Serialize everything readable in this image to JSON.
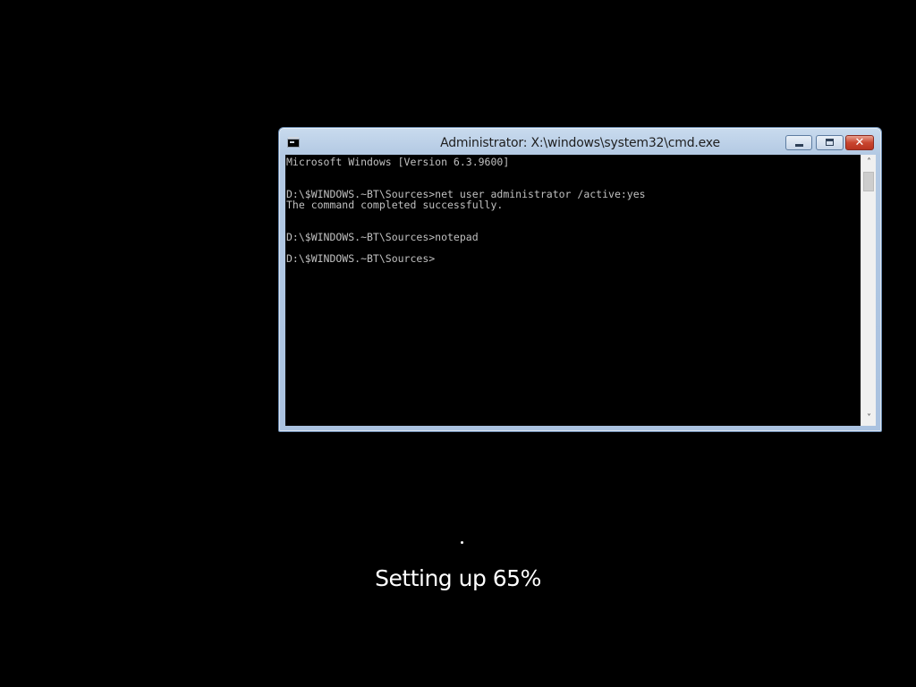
{
  "window": {
    "title": "Administrator: X:\\windows\\system32\\cmd.exe",
    "icon": "cmd-icon"
  },
  "caption_buttons": {
    "minimize_icon": "minimize-icon",
    "maximize_icon": "maximize-icon",
    "close_icon": "close-icon",
    "close_glyph": "✕"
  },
  "console": {
    "text": "Microsoft Windows [Version 6.3.9600]\n\n\nD:\\$WINDOWS.~BT\\Sources>net user administrator /active:yes\nThe command completed successfully.\n\n\nD:\\$WINDOWS.~BT\\Sources>notepad\n\nD:\\$WINDOWS.~BT\\Sources>"
  },
  "scrollbar": {
    "up_glyph": "˄",
    "down_glyph": "˅"
  },
  "setup": {
    "status": "Setting up 65%",
    "progress_percent": 65
  },
  "colors": {
    "desktop_background": "#000000",
    "console_text": "#c0c0c0",
    "window_frame": "#aac2e0",
    "close_button": "#c9452f"
  }
}
